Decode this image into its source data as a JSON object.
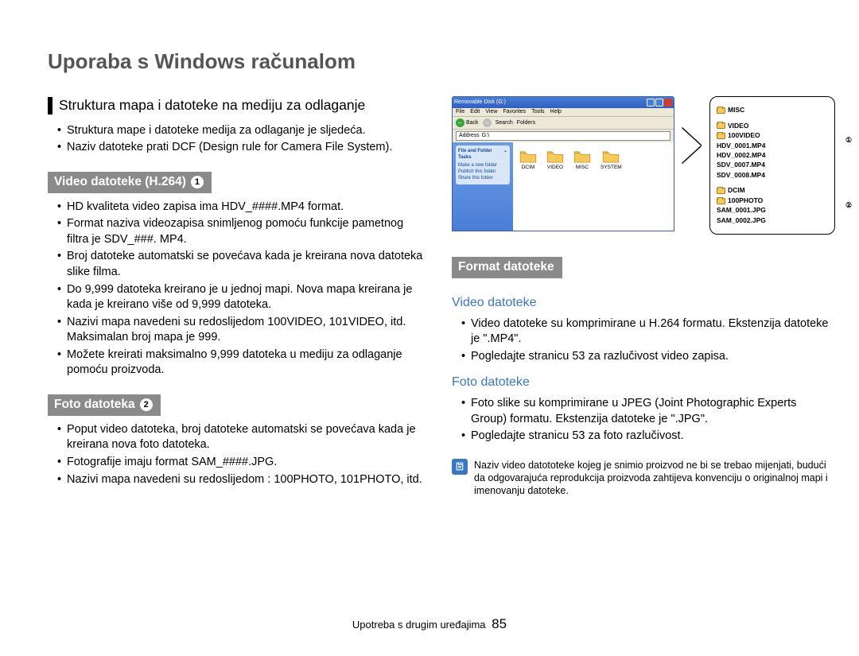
{
  "page_title": "Uporaba s Windows računalom",
  "section_heading": "Struktura mapa i datoteke na mediju za odlaganje",
  "intro_bullets": [
    "Struktura mape i datoteke medija za odlaganje je sljedeća.",
    "Naziv datoteke prati DCF (Design rule for Camera File System)."
  ],
  "video_heading": "Video datoteke (H.264)",
  "video_badge": "1",
  "video_bullets": [
    "HD kvaliteta video zapisa ima HDV_####.MP4 format.",
    "Format naziva videozapisa snimljenog pomoću funkcije pametnog filtra je SDV_###. MP4.",
    "Broj datoteke automatski se povećava kada je kreirana nova datoteka slike filma.",
    "Do 9,999 datoteka kreirano je u jednoj mapi. Nova mapa kreirana je kada je kreirano više od 9,999 datoteka.",
    "Nazivi mapa navedeni su redoslijedom 100VIDEO, 101VIDEO, itd. Maksimalan broj mapa je 999.",
    "Možete kreirati maksimalno 9,999 datoteka u mediju za odlaganje pomoću proizvoda."
  ],
  "foto_heading": "Foto datoteka",
  "foto_badge": "2",
  "foto_bullets": [
    "Poput video datoteka, broj datoteke automatski se povećava kada je kreirana nova foto datoteka.",
    "Fotografije imaju format SAM_####.JPG.",
    "Nazivi mapa navedeni su redoslijedom : 100PHOTO, 101PHOTO, itd."
  ],
  "format_heading": "Format datoteke",
  "format_video_h": "Video datoteke",
  "format_video_bullets": [
    "Video datoteke su komprimirane u H.264 formatu. Ekstenzija datoteke je \".MP4\".",
    "Pogledajte stranicu 53 za razlučivost video zapisa."
  ],
  "format_foto_h": "Foto datoteke",
  "format_foto_bullets": [
    "Foto slike su komprimirane u JPEG (Joint Photographic Experts Group) formatu. Ekstenzija datoteke je \".JPG\".",
    "Pogledajte stranicu 53 za foto razlučivost."
  ],
  "note_text": "Naziv video datototeke kojeg je snimio proizvod ne bi se trebao mijenjati, budući da odgovarajuća reprodukcija proizvoda zahtijeva konvenciju o originalnoj mapi i imenovanju datoteke.",
  "explorer": {
    "title": "Removable Disk (G:)",
    "menu": [
      "File",
      "Edit",
      "View",
      "Favorites",
      "Tools",
      "Help"
    ],
    "back": "Back",
    "search": "Search",
    "folders_btn": "Folders",
    "addr_label": "Address",
    "addr_value": "G:\\",
    "panel1_title": "File and Folder Tasks",
    "panel1_items": [
      "Make a new folder",
      "Publish this folder",
      "Share this folder"
    ],
    "folders": [
      "DCIM",
      "VIDEO",
      "MISC",
      "SYSTEM"
    ]
  },
  "tree": {
    "misc": "MISC",
    "video": "VIDEO",
    "video_sub": "100VIDEO",
    "video_files": [
      "HDV_0001.MP4",
      "HDV_0002.MP4",
      "SDV_0007.MP4",
      "SDV_0008.MP4"
    ],
    "dcim": "DCIM",
    "dcim_sub": "100PHOTO",
    "dcim_files": [
      "SAM_0001.JPG",
      "SAM_0002.JPG"
    ],
    "mark1": "①",
    "mark2": "②"
  },
  "footer_text": "Upotreba s drugim uređajima",
  "footer_page": "85"
}
